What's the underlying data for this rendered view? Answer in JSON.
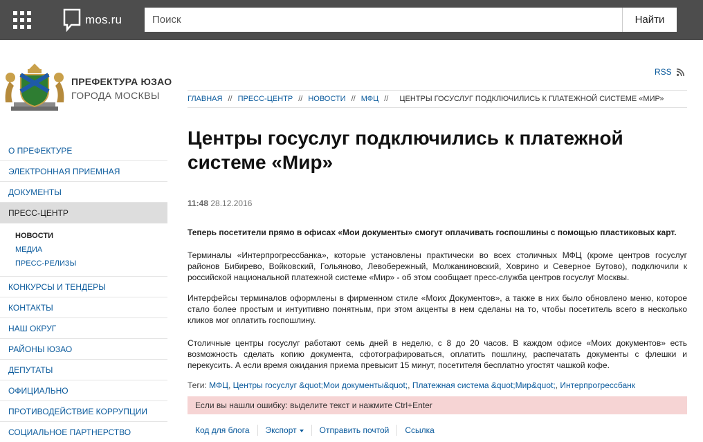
{
  "header": {
    "logo_text": "mos.ru",
    "search_placeholder": "Поиск",
    "search_button": "Найти"
  },
  "brand": {
    "title": "ПРЕФЕКТУРА ЮЗАО",
    "subtitle": "ГОРОДА МОСКВЫ"
  },
  "nav": {
    "items": [
      {
        "label": "О ПРЕФЕКТУРЕ"
      },
      {
        "label": "ЭЛЕКТРОННАЯ ПРИЕМНАЯ"
      },
      {
        "label": "ДОКУМЕНТЫ"
      },
      {
        "label": "ПРЕСС-ЦЕНТР"
      },
      {
        "label": "КОНКУРСЫ И ТЕНДЕРЫ"
      },
      {
        "label": "КОНТАКТЫ"
      },
      {
        "label": "НАШ ОКРУГ"
      },
      {
        "label": "РАЙОНЫ ЮЗАО"
      },
      {
        "label": "ДЕПУТАТЫ"
      },
      {
        "label": "ОФИЦИАЛЬНО"
      },
      {
        "label": "ПРОТИВОДЕЙСТВИЕ КОРРУПЦИИ"
      },
      {
        "label": "СОЦИАЛЬНОЕ ПАРТНЕРСТВО"
      }
    ],
    "subitems": [
      {
        "label": "НОВОСТИ"
      },
      {
        "label": "МЕДИА"
      },
      {
        "label": "ПРЕСС-РЕЛИЗЫ"
      }
    ]
  },
  "rss": "RSS",
  "breadcrumb": {
    "items": [
      "ГЛАВНАЯ",
      "ПРЕСС-ЦЕНТР",
      "НОВОСТИ",
      "МФЦ"
    ],
    "separator": "//",
    "current": "ЦЕНТРЫ ГОСУСЛУГ ПОДКЛЮЧИЛИСЬ К ПЛАТЕЖНОЙ СИСТЕМЕ «МИР»"
  },
  "article": {
    "title": "Центры госуслуг подключились к платежной системе «Мир»",
    "time": "11:48",
    "date": "28.12.2016",
    "lead": "Теперь посетители прямо в офисах «Мои документы» смогут оплачивать госпошлины с помощью пластиковых карт.",
    "paragraphs": [
      "Терминалы «Интерпрогрессбанка», которые установлены практически во всех столичных МФЦ (кроме центров госуслуг районов Бибирево, Войковский, Гольяново, Левобережный, Молжаниновский, Ховрино и Северное Бутово), подключили к российской национальной платежной системе «Мир» - об этом сообщает пресс-служба центров госуслуг Москвы.",
      "Интерфейсы терминалов оформлены в фирменном стиле «Моих Документов», а также в них было обновлено меню, которое стало более простым и интуитивно понятным, при этом акценты в нем сделаны на то, чтобы посетитель всего в несколько кликов мог оплатить госпошлину.",
      "Столичные центры госуслуг работают семь дней в неделю, с 8 до 20 часов. В каждом офисе «Моих документов» есть возможность сделать копию документа, сфотографироваться, оплатить пошлину, распечатать документы с флешки и перекусить. А если время ожидания приема превысит 15 минут, посетителя бесплатно угостят чашкой кофе."
    ],
    "tags_label": "Теги:",
    "tags": [
      "МФЦ",
      "Центры госуслуг &quot;Мои документы&quot;",
      "Платежная система &quot;Мир&quot;",
      "Интерпрогрессбанк"
    ],
    "error_notice": "Если вы нашли ошибку: выделите текст и нажмите Ctrl+Enter"
  },
  "actions": {
    "blog_code": "Код для блога",
    "export": "Экспорт",
    "send_mail": "Отправить почтой",
    "link": "Ссылка"
  },
  "colors": {
    "topbar": "#4d4d4d",
    "link": "#0a5a9c",
    "active_nav": "#dddddd",
    "error_bar": "#f6d4d4",
    "rss": "#f26522"
  }
}
